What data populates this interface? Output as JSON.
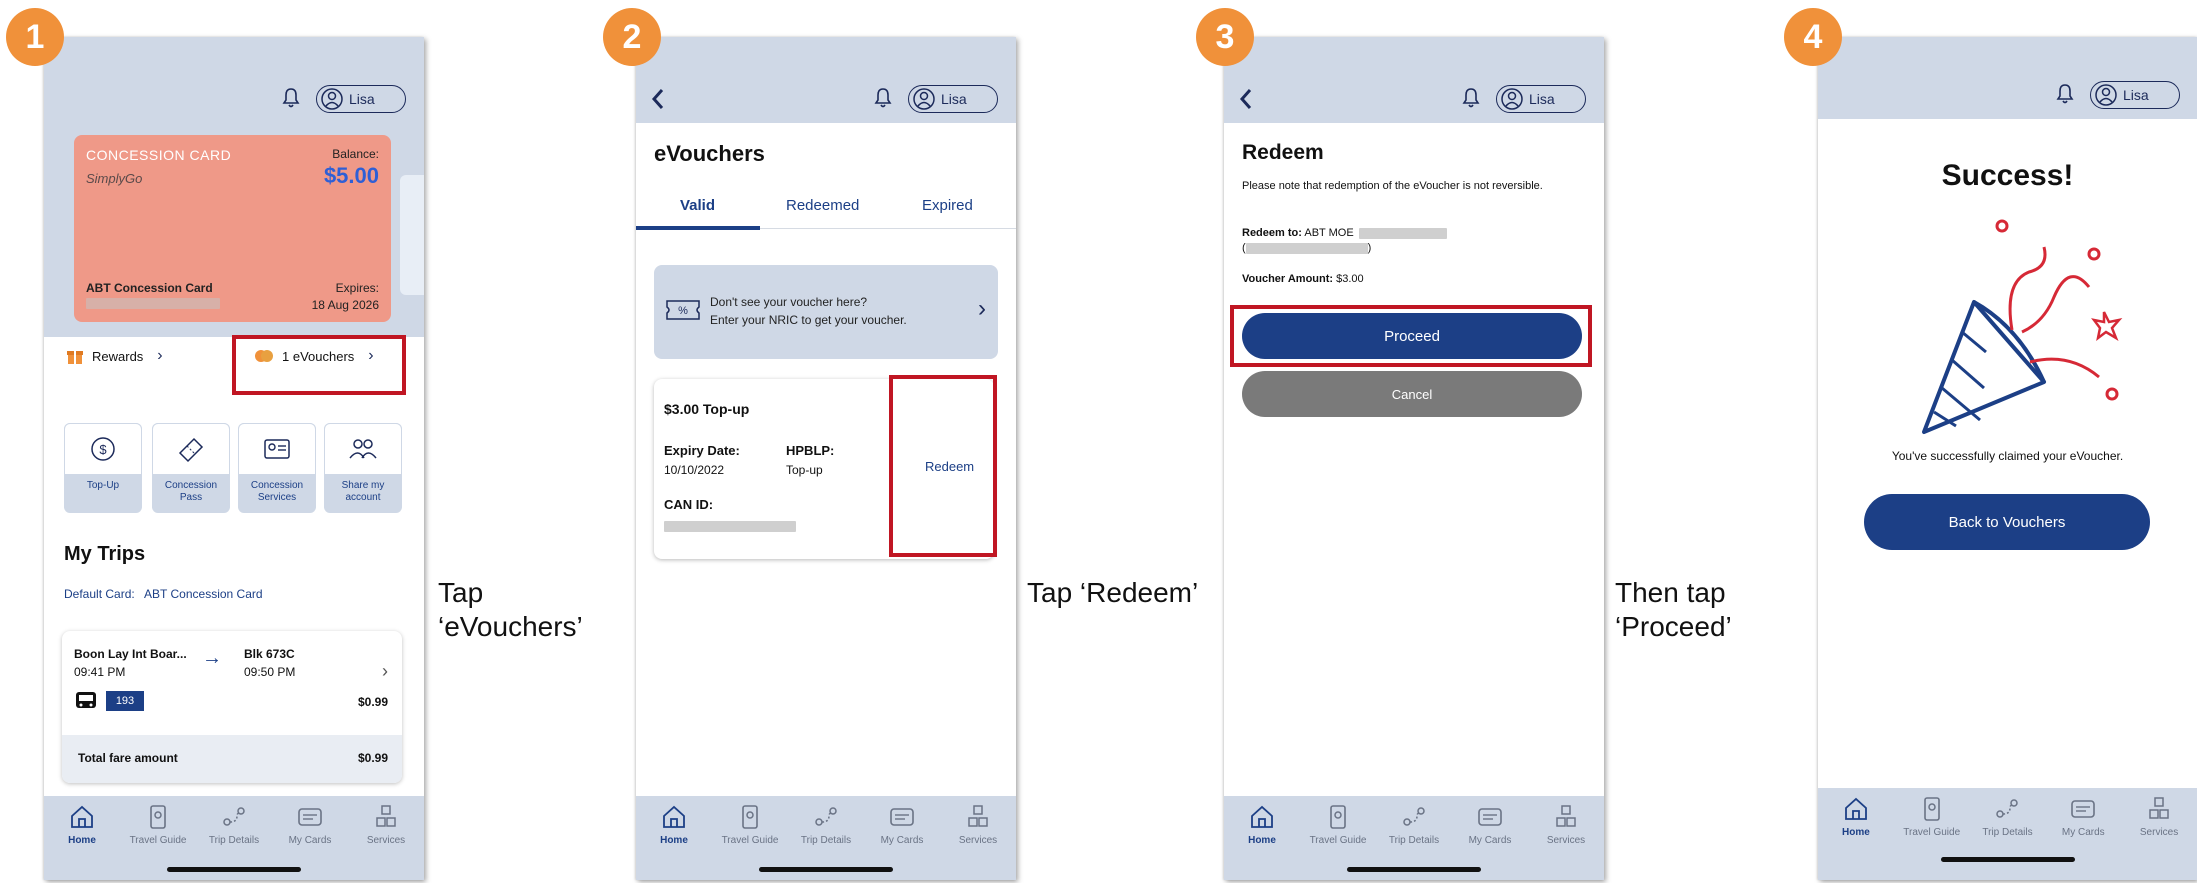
{
  "steps": [
    {
      "number": "1",
      "caption_line1": "Tap",
      "caption_line2": "‘eVouchers’"
    },
    {
      "number": "2",
      "caption_line1": "Tap ‘Redeem’",
      "caption_line2": ""
    },
    {
      "number": "3",
      "caption_line1": "Then tap",
      "caption_line2": "‘Proceed’"
    },
    {
      "number": "4",
      "caption_line1": "",
      "caption_line2": ""
    }
  ],
  "header": {
    "user_name": "Lisa"
  },
  "nav": {
    "items": [
      "Home",
      "Travel Guide",
      "Trip Details",
      "My Cards",
      "Services"
    ]
  },
  "screen1": {
    "card_type": "CONCESSION CARD",
    "brand": "SimplyGo",
    "balance_label": "Balance:",
    "balance_value": "$5.00",
    "card_name": "ABT Concession Card",
    "expires_label": "Expires:",
    "expires_value": "18 Aug 2026",
    "rewards_label": "Rewards",
    "evouchers_label": "1 eVouchers",
    "tiles": [
      {
        "line1": "Top-Up",
        "line2": ""
      },
      {
        "line1": "Concession",
        "line2": "Pass"
      },
      {
        "line1": "Concession",
        "line2": "Services"
      },
      {
        "line1": "Share my",
        "line2": "account"
      }
    ],
    "my_trips_title": "My Trips",
    "default_card_label": "Default Card:",
    "default_card_value": "ABT Concession Card",
    "trip": {
      "from_stop": "Boon Lay Int Boar...",
      "from_time": "09:41 PM",
      "to_stop": "Blk 673C",
      "to_time": "09:50 PM",
      "bus_number": "193",
      "fare": "$0.99",
      "total_label": "Total fare amount",
      "total_value": "$0.99"
    }
  },
  "screen2": {
    "title": "eVouchers",
    "tabs": [
      "Valid",
      "Redeemed",
      "Expired"
    ],
    "banner_line1": "Don't see your voucher here?",
    "banner_line2": "Enter your NRIC to get your voucher.",
    "voucher_title": "$3.00 Top-up",
    "expiry_label": "Expiry Date:",
    "expiry_value": "10/10/2022",
    "type_label": "HPBLP:",
    "type_value": "Top-up",
    "can_label": "CAN ID:",
    "redeem_label": "Redeem"
  },
  "screen3": {
    "title": "Redeem",
    "note": "Please note that redemption of the eVoucher is not reversible.",
    "redeem_to_label": "Redeem to:",
    "redeem_to_value": "ABT MOE",
    "amount_label": "Voucher Amount:",
    "amount_value": "$3.00",
    "proceed_label": "Proceed",
    "cancel_label": "Cancel"
  },
  "screen4": {
    "title": "Success!",
    "message": "You've successfully claimed your eVoucher.",
    "back_label": "Back to Vouchers"
  },
  "colors": {
    "accent_orange": "#f0913a",
    "navy": "#1c3f86",
    "header_blue": "#cfd8e6",
    "card_salmon": "#ef9988",
    "highlight_red": "#c01623"
  }
}
